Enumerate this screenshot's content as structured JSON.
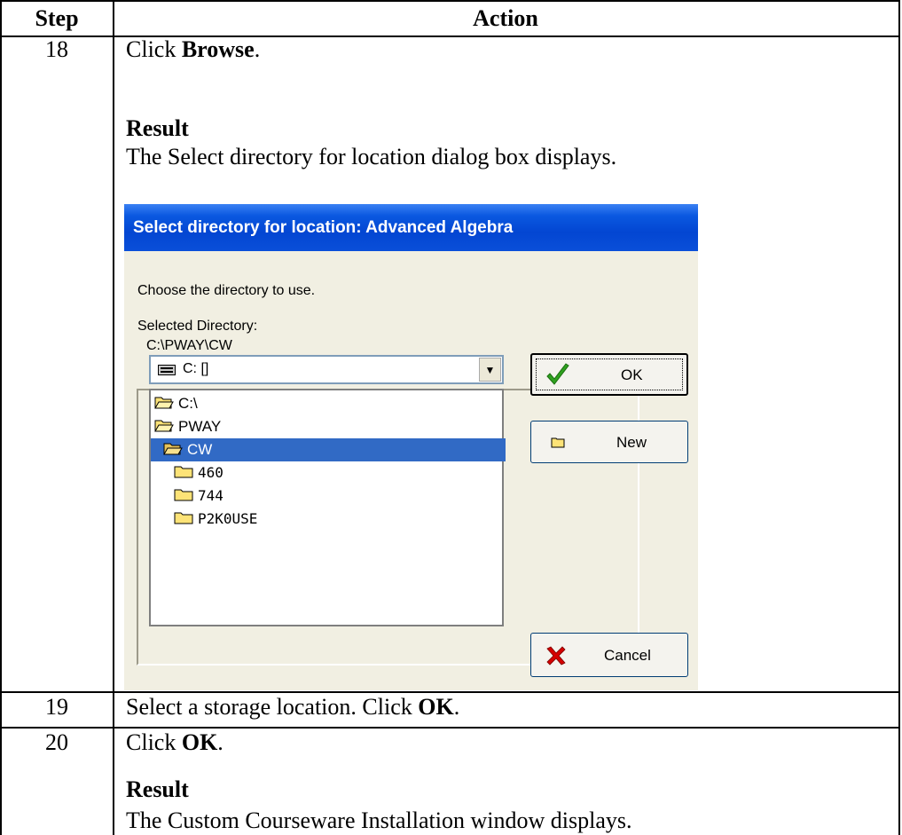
{
  "table": {
    "header_step": "Step",
    "header_action": "Action"
  },
  "rows": [
    {
      "step": "18",
      "line1_prefix": "Click ",
      "line1_bold": "Browse",
      "line1_suffix": ".",
      "result_label": "Result",
      "result_text": "The Select directory for location dialog box displays."
    },
    {
      "step": "19",
      "line1_prefix": "Select a storage location.  Click ",
      "line1_bold": "OK",
      "line1_suffix": "."
    },
    {
      "step": "20",
      "line1_prefix": "Click ",
      "line1_bold": "OK",
      "line1_suffix": ".",
      "result_label": "Result",
      "result_text": "The Custom Courseware Installation window displays."
    }
  ],
  "dialog": {
    "title": "Select directory for location: Advanced Algebra",
    "instruction": "Choose the directory to use.",
    "selected_label": "Selected Directory:",
    "selected_path": "C:\\PWAY\\CW",
    "drive_value": "C: []",
    "tree": [
      {
        "label": "C:\\",
        "selected": false
      },
      {
        "label": "PWAY",
        "selected": false
      },
      {
        "label": "CW",
        "selected": true
      },
      {
        "label": "460",
        "selected": false
      },
      {
        "label": "744",
        "selected": false
      },
      {
        "label": "P2K0USE",
        "selected": false
      }
    ],
    "ok_label": "OK",
    "new_label": "New",
    "cancel_label": "Cancel",
    "colors": {
      "title_bar": "#0346d2",
      "dialog_bg": "#f1efe2",
      "selection": "#316ac5",
      "folder": "#fde377",
      "ok_check": "#2fa11f",
      "cancel_x": "#d40000"
    }
  }
}
